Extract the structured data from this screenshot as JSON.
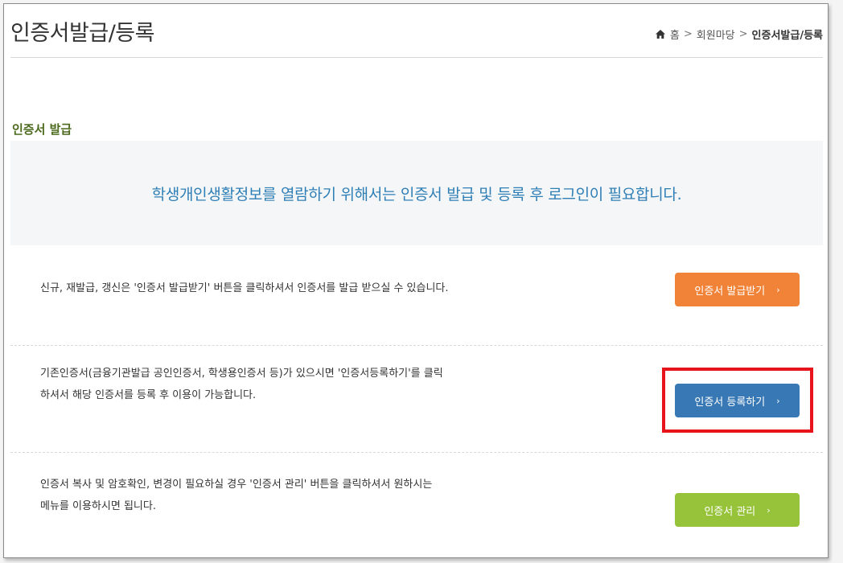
{
  "header": {
    "title": "인증서발급/등록",
    "breadcrumb": {
      "home": "홈",
      "level1": "회원마당",
      "current": "인증서발급/등록"
    }
  },
  "section": {
    "title": "인증서 발급"
  },
  "notice": {
    "text": "학생개인생활정보를 열람하기 위해서는 인증서 발급 및 등록 후 로그인이 필요합니다."
  },
  "rows": [
    {
      "lines": [
        "신규, 재발급, 갱신은 '인증서 발급받기' 버튼을 클릭하셔서 인증서를 발급 받으실 수 있습니다."
      ],
      "button_label": "인증서 발급받기",
      "button_color": "#f08338"
    },
    {
      "lines": [
        "기존인증서(금융기관발급 공인인증서, 학생용인증서 등)가 있으시면 '인증서등록하기'를 클릭",
        "하셔서 해당 인증서를 등록 후 이용이 가능합니다."
      ],
      "button_label": "인증서 등록하기",
      "button_color": "#3878b4",
      "highlighted": true
    },
    {
      "lines": [
        "인증서 복사 및 암호확인, 변경이 필요하실 경우 '인증서 관리' 버튼을 클릭하셔서 원하시는",
        "메뉴를 이용하시면 됩니다."
      ],
      "button_label": "인증서 관리",
      "button_color": "#96c33a"
    }
  ],
  "icons": {
    "home": "home-icon",
    "chevron": "chevron-right-icon"
  },
  "colors": {
    "highlight": "#e8141b",
    "notice_text": "#2f7fb7",
    "section_title": "#4b6a1c"
  }
}
